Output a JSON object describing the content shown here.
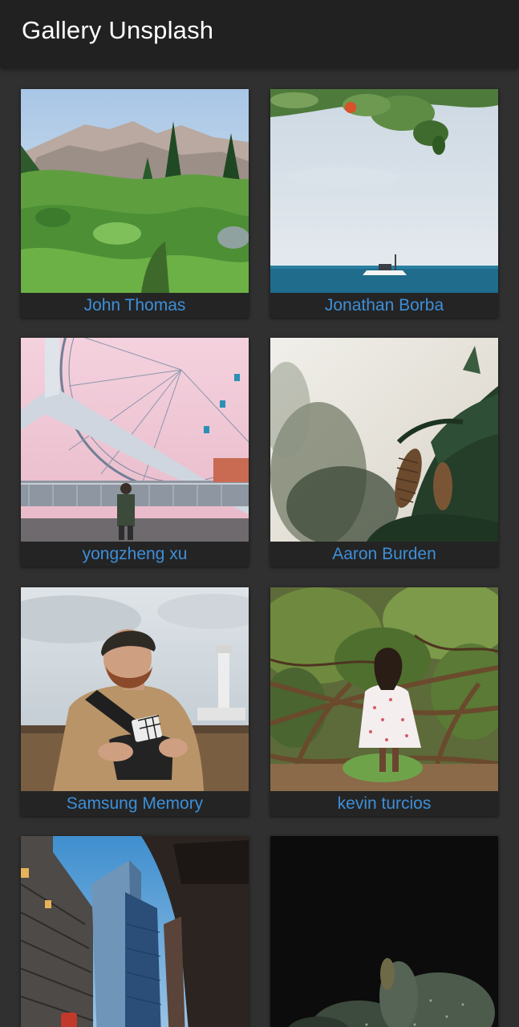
{
  "app": {
    "title": "Gallery Unsplash"
  },
  "colors": {
    "app_bar": "#212121",
    "background": "#303030",
    "caption_bar": "#242424",
    "caption_text": "#3d8fd9"
  },
  "photos": [
    {
      "author": "John Thomas",
      "subject": "alpine meadow with mountains"
    },
    {
      "author": "Jonathan Borba",
      "subject": "boat on sea under leaves"
    },
    {
      "author": "yongzheng xu",
      "subject": "ferris wheel bridge"
    },
    {
      "author": "Aaron Burden",
      "subject": "pine cones on branch"
    },
    {
      "author": "Samsung Memory",
      "subject": "man with beanie near lighthouse"
    },
    {
      "author": "kevin turcios",
      "subject": "woman in white dress among trees"
    },
    {
      "author": "",
      "subject": "skyscrapers looking up"
    },
    {
      "author": "",
      "subject": "dark cactus"
    }
  ]
}
